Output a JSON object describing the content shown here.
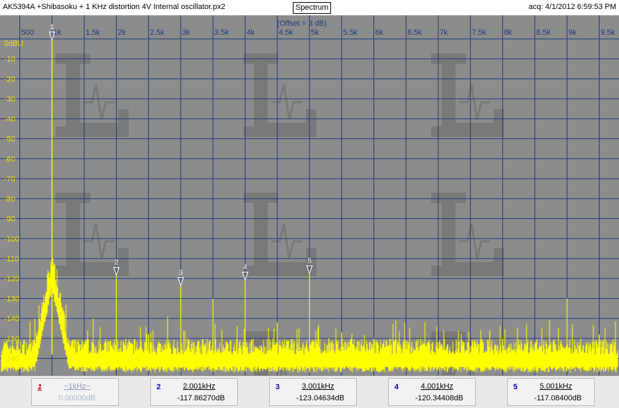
{
  "window": {
    "title": "AK5394A +Shibasoku + 1 KHz distortion 4V Internal oscillator.px2",
    "mode_button": "Spectrum",
    "acquired": "acq: 4/1/2012 6:59:53 PM"
  },
  "chart_data": {
    "type": "line",
    "offset_label": "(Offset = 3 dB)",
    "y_unit_label": "0dBU",
    "x_ticks": [
      {
        "v": 500,
        "l": "500"
      },
      {
        "v": 1000,
        "l": "1k"
      },
      {
        "v": 1500,
        "l": "1.5k"
      },
      {
        "v": 2000,
        "l": "2k"
      },
      {
        "v": 2500,
        "l": "2.5k"
      },
      {
        "v": 3000,
        "l": "3k"
      },
      {
        "v": 3500,
        "l": "3.5k"
      },
      {
        "v": 4000,
        "l": "4k"
      },
      {
        "v": 4500,
        "l": "4.5k"
      },
      {
        "v": 5000,
        "l": "5k"
      },
      {
        "v": 5500,
        "l": "5.5k"
      },
      {
        "v": 6000,
        "l": "6k"
      },
      {
        "v": 6500,
        "l": "6.5k"
      },
      {
        "v": 7000,
        "l": "7k"
      },
      {
        "v": 7500,
        "l": "7.5k"
      },
      {
        "v": 8000,
        "l": "8k"
      },
      {
        "v": 8500,
        "l": "8.5k"
      },
      {
        "v": 9000,
        "l": "9k"
      },
      {
        "v": 9500,
        "l": "9.5k"
      }
    ],
    "y_ticks": [
      {
        "v": -10,
        "l": "-10"
      },
      {
        "v": -20,
        "l": "-20"
      },
      {
        "v": -30,
        "l": "-30"
      },
      {
        "v": -40,
        "l": "-40"
      },
      {
        "v": -50,
        "l": "-50"
      },
      {
        "v": -60,
        "l": "-60"
      },
      {
        "v": -70,
        "l": "-70"
      },
      {
        "v": -80,
        "l": "-80"
      },
      {
        "v": -90,
        "l": "-90"
      },
      {
        "v": -100,
        "l": "-100"
      },
      {
        "v": -110,
        "l": "-110"
      },
      {
        "v": -120,
        "l": "-120"
      },
      {
        "v": -130,
        "l": "-130"
      },
      {
        "v": -140,
        "l": "-140"
      },
      {
        "v": -150,
        "l": "-150"
      },
      {
        "v": -160,
        "l": "-160"
      }
    ],
    "xlim": [
      300,
      9700
    ],
    "ylim": [
      -165,
      0
    ],
    "noise_floor_db": -158,
    "fundamental": {
      "freq": 1000,
      "db": 0
    },
    "spurs": [
      {
        "freq": 1500,
        "db": -153
      },
      {
        "freq": 2000,
        "db": -117.9
      },
      {
        "freq": 2500,
        "db": -148
      },
      {
        "freq": 3000,
        "db": -123.0
      },
      {
        "freq": 3500,
        "db": -130
      },
      {
        "freq": 4000,
        "db": -120.3
      },
      {
        "freq": 4500,
        "db": -142
      },
      {
        "freq": 5000,
        "db": -117.1
      },
      {
        "freq": 5300,
        "db": -150
      },
      {
        "freq": 5500,
        "db": -147
      },
      {
        "freq": 6000,
        "db": -150
      },
      {
        "freq": 6500,
        "db": -151
      },
      {
        "freq": 7400,
        "db": -152
      },
      {
        "freq": 7800,
        "db": -146
      },
      {
        "freq": 8000,
        "db": -150
      },
      {
        "freq": 9000,
        "db": -130
      },
      {
        "freq": 9500,
        "db": -148
      }
    ],
    "markers": [
      {
        "n": "1",
        "freq": 1000,
        "db": 0
      },
      {
        "n": "2",
        "freq": 2000,
        "db": -117.9
      },
      {
        "n": "3",
        "freq": 3000,
        "db": -123.0
      },
      {
        "n": "4",
        "freq": 4000,
        "db": -120.3
      },
      {
        "n": "5",
        "freq": 5000,
        "db": -117.1
      }
    ],
    "colors": {
      "plot_bg": "#8c8c8c",
      "grid": "#1c3a7a",
      "trace": "#ffff00",
      "label": "#f0e000",
      "offset": "#1c3a7a"
    }
  },
  "marker_readouts": [
    {
      "n": "1",
      "freq": "~1kHz~",
      "db": "0.00000dB"
    },
    {
      "n": "2",
      "freq": "2.001kHz",
      "db": "-117.86270dB"
    },
    {
      "n": "3",
      "freq": "3.001kHz",
      "db": "-123.04634dB"
    },
    {
      "n": "4",
      "freq": "4.001kHz",
      "db": "-120.34408dB"
    },
    {
      "n": "5",
      "freq": "5.001kHz",
      "db": "-117.08400dB"
    }
  ]
}
